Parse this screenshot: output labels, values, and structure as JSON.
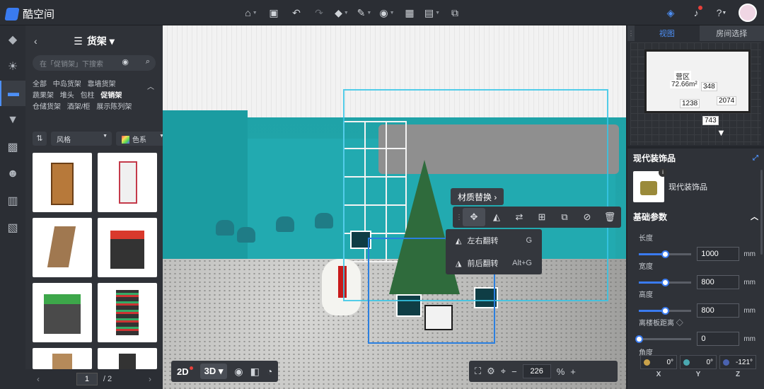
{
  "app": {
    "name": "酷空间"
  },
  "topbar": {
    "icons": [
      "home-icon",
      "save-icon",
      "undo-icon",
      "redo-icon",
      "eraser-icon",
      "wrench-icon",
      "camera-icon",
      "image-icon",
      "file-icon",
      "export-icon"
    ],
    "right_icons": [
      "plugin-icon",
      "bell-icon",
      "help-icon"
    ]
  },
  "sidebar": {
    "items": [
      "model-icon",
      "light-icon",
      "furniture-icon",
      "v-icon",
      "layout-icon",
      "person-icon",
      "gallery-icon",
      "panel-icon"
    ]
  },
  "library": {
    "title": "货架",
    "search_placeholder": "在「促销架」下搜索",
    "categories": [
      "全部",
      "中岛货架",
      "靠墙货架",
      "蔬果架",
      "堆头",
      "包柱",
      "促销架",
      "仓储货架",
      "酒架/柜",
      "展示陈列架"
    ],
    "selected_category": "促销架",
    "filter_style": "风格",
    "filter_color": "色系",
    "pager": {
      "current": "1",
      "total": "/ 2"
    }
  },
  "viewport": {
    "material_replace": "材质替换",
    "flip": [
      {
        "label": "左右翻转",
        "key": "G"
      },
      {
        "label": "前后翻转",
        "key": "Alt+G"
      }
    ],
    "view_2d": "2D",
    "view_3d": "3D",
    "zoom": "226",
    "zoom_unit": "%"
  },
  "minimap": {
    "tabs": [
      "视图",
      "房间选择"
    ],
    "room_name": "营区",
    "room_area": "72.66m²",
    "dims": [
      "348",
      "1238",
      "2074",
      "743"
    ]
  },
  "properties": {
    "title": "现代装饰品",
    "item_name": "现代装饰品",
    "section": "基础参数",
    "length": {
      "label": "长度",
      "value": "1000",
      "unit": "mm",
      "fraction": 0.5
    },
    "width": {
      "label": "宽度",
      "value": "800",
      "unit": "mm",
      "fraction": 0.5
    },
    "height": {
      "label": "高度",
      "value": "800",
      "unit": "mm",
      "fraction": 0.5
    },
    "floor": {
      "label": "离楼板距离",
      "value": "0",
      "unit": "mm",
      "fraction": 0.0
    },
    "angle": {
      "label": "角度",
      "x": "0°",
      "y": "0°",
      "z": "-121°",
      "axes": [
        "X",
        "Y",
        "Z"
      ]
    }
  }
}
